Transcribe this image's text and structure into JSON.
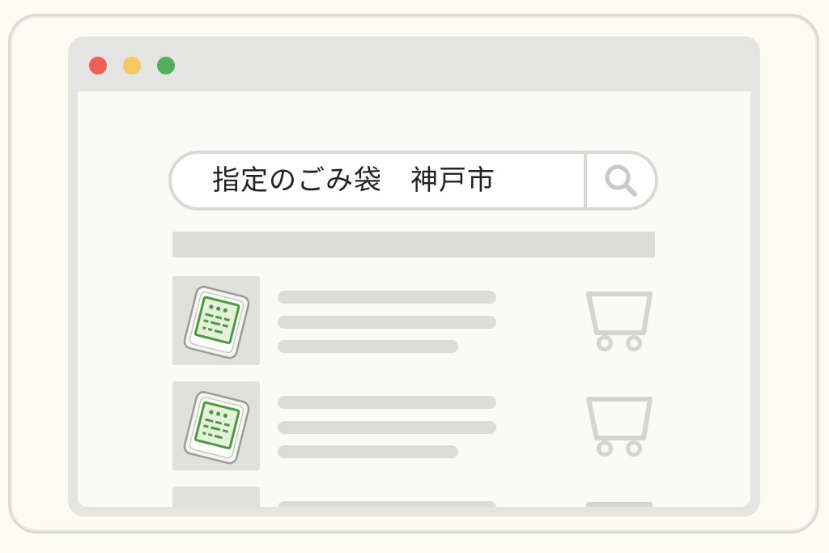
{
  "browser": {
    "window_controls": [
      {
        "name": "close",
        "color": "#ee5f57"
      },
      {
        "name": "minimize",
        "color": "#f6c85f"
      },
      {
        "name": "maximize",
        "color": "#54ad5c"
      }
    ]
  },
  "search": {
    "query": "指定のごみ袋　神戸市",
    "button_icon": "search-icon"
  },
  "results": [
    {
      "thumbnail": "garbage-bag-package-icon",
      "cart_icon": "shopping-cart-icon"
    },
    {
      "thumbnail": "garbage-bag-package-icon",
      "cart_icon": "shopping-cart-icon"
    },
    {
      "thumbnail": "blank-thumbnail",
      "cart_icon": "shopping-cart-icon"
    }
  ],
  "colors": {
    "placeholder_gray": "#dcdcd9",
    "icon_gray": "#d4d4d1",
    "package_green": "#4a9a3e"
  }
}
